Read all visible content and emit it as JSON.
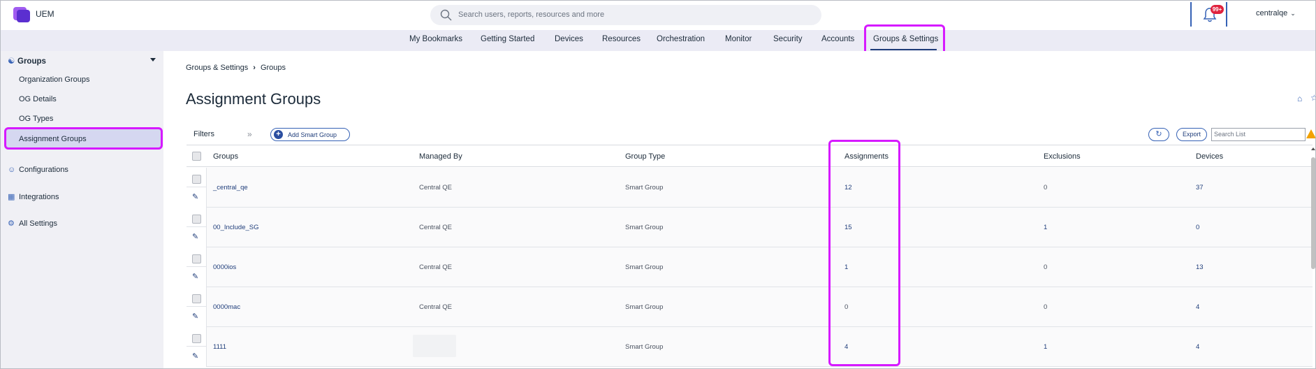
{
  "app": {
    "title": "UEM"
  },
  "search": {
    "placeholder": "Search users, reports, resources and more"
  },
  "notifications": {
    "badge": "99+"
  },
  "user": {
    "name": "centralqe"
  },
  "nav": {
    "items": [
      "My Bookmarks",
      "Getting Started",
      "Devices",
      "Resources",
      "Orchestration",
      "Monitor",
      "Security",
      "Accounts",
      "Groups & Settings"
    ],
    "active": "Groups & Settings"
  },
  "sidebar": {
    "header": "Groups",
    "sub_items": [
      "Organization Groups",
      "OG Details",
      "OG Types",
      "Assignment Groups"
    ],
    "active": "Assignment Groups",
    "sections": [
      "Configurations",
      "Integrations",
      "All Settings"
    ]
  },
  "breadcrumb": {
    "parent": "Groups & Settings",
    "current": "Groups"
  },
  "page": {
    "title": "Assignment Groups"
  },
  "toolbar": {
    "filters_label": "Filters",
    "add_smart_group_label": "Add Smart Group",
    "export_label": "Export",
    "search_placeholder": "Search List"
  },
  "table": {
    "columns": [
      "Groups",
      "Managed By",
      "Group Type",
      "Assignments",
      "Exclusions",
      "Devices"
    ],
    "rows": [
      {
        "group": "_central_qe",
        "managed_by": "Central QE",
        "group_type": "Smart Group",
        "assignments": "12",
        "exclusions": "0",
        "devices": "37"
      },
      {
        "group": "00_Include_SG",
        "managed_by": "Central QE",
        "group_type": "Smart Group",
        "assignments": "15",
        "exclusions": "1",
        "devices": "0"
      },
      {
        "group": "0000ios",
        "managed_by": "Central QE",
        "group_type": "Smart Group",
        "assignments": "1",
        "exclusions": "0",
        "devices": "13"
      },
      {
        "group": "0000mac",
        "managed_by": "Central QE",
        "group_type": "Smart Group",
        "assignments": "0",
        "exclusions": "0",
        "devices": "4"
      },
      {
        "group": "1111",
        "managed_by": "",
        "group_type": "Smart Group",
        "assignments": "4",
        "exclusions": "1",
        "devices": "4"
      }
    ]
  },
  "colors": {
    "highlight": "#d61aff",
    "accent": "#1f3d7a",
    "nav_bg": "#ebebf5",
    "badge": "#e0223d",
    "warning": "#f2a200"
  }
}
